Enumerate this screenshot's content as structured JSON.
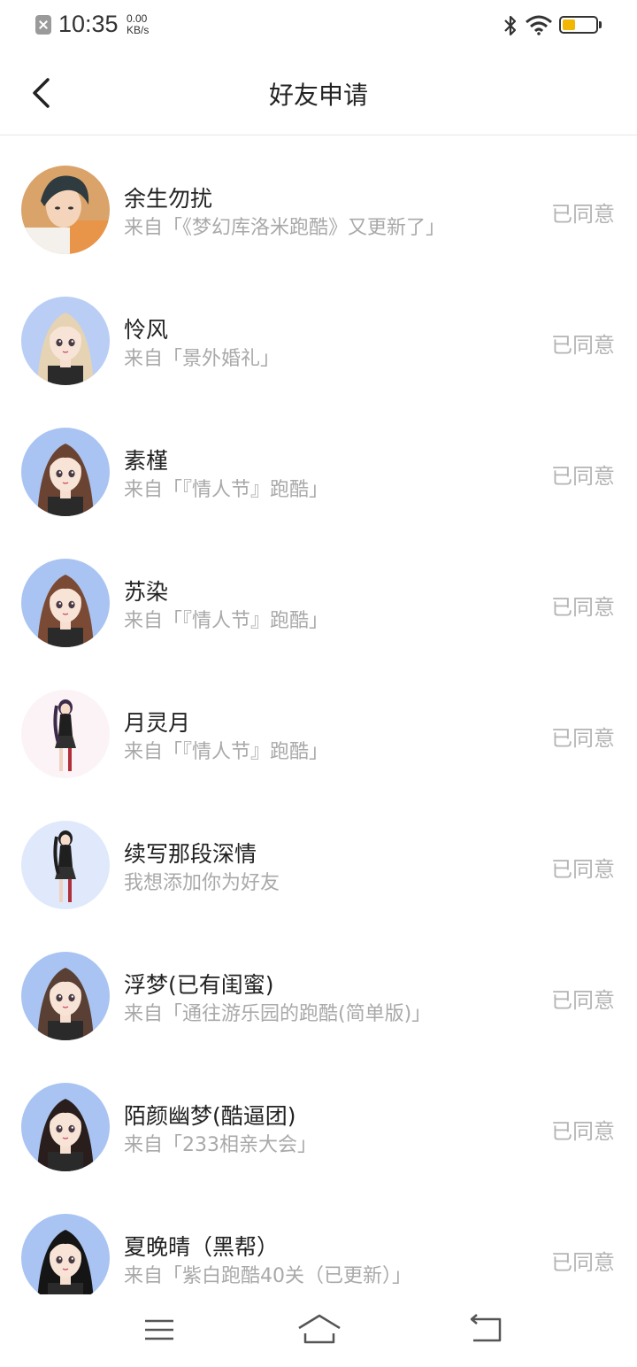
{
  "status_bar": {
    "time": "10:35",
    "speed_value": "0.00",
    "speed_unit": "KB/s",
    "battery_color": "#f2b705"
  },
  "header": {
    "title": "好友申请",
    "back_icon": "chevron-left-icon"
  },
  "requests": [
    {
      "name": "余生勿扰",
      "source": "来自「《梦幻库洛米跑酷》又更新了」",
      "status": "已同意",
      "avatar_bg": "#d9a36a",
      "hair": "#2f3b3f",
      "style": "boy"
    },
    {
      "name": "怜风",
      "source": "来自「景外婚礼」",
      "status": "已同意",
      "avatar_bg": "#b9cdf5",
      "hair": "#e6d3b3",
      "style": "girl"
    },
    {
      "name": "素槿",
      "source": "来自「『情人节』跑酷」",
      "status": "已同意",
      "avatar_bg": "#a9c4f2",
      "hair": "#6b4332",
      "style": "girl"
    },
    {
      "name": "苏染",
      "source": "来自「『情人节』跑酷」",
      "status": "已同意",
      "avatar_bg": "#a9c4f2",
      "hair": "#7a4a35",
      "style": "girl"
    },
    {
      "name": "月灵月",
      "source": "来自「『情人节』跑酷」",
      "status": "已同意",
      "avatar_bg": "#fbf3f5",
      "hair": "#3c2a4a",
      "style": "full"
    },
    {
      "name": "续写那段深情",
      "source": "我想添加你为好友",
      "status": "已同意",
      "avatar_bg": "#dfe9fb",
      "hair": "#1e1e1e",
      "style": "full"
    },
    {
      "name": "浮梦(已有闺蜜)",
      "source": "来自「通往游乐园的跑酷(简单版)」",
      "status": "已同意",
      "avatar_bg": "#a9c4f2",
      "hair": "#5a4034",
      "style": "girl"
    },
    {
      "name": "陌颜幽梦(酷逼团)",
      "source": "来自「233相亲大会」",
      "status": "已同意",
      "avatar_bg": "#a9c4f2",
      "hair": "#2a1e1c",
      "style": "girl"
    },
    {
      "name": "夏晚晴（黑帮）",
      "source": "来自「紫白跑酷40关（已更新）」",
      "status": "已同意",
      "avatar_bg": "#a9c4f2",
      "hair": "#151515",
      "style": "girl"
    }
  ],
  "nav": {
    "menu_icon": "menu-icon",
    "home_icon": "home-icon",
    "back_icon": "return-icon"
  }
}
